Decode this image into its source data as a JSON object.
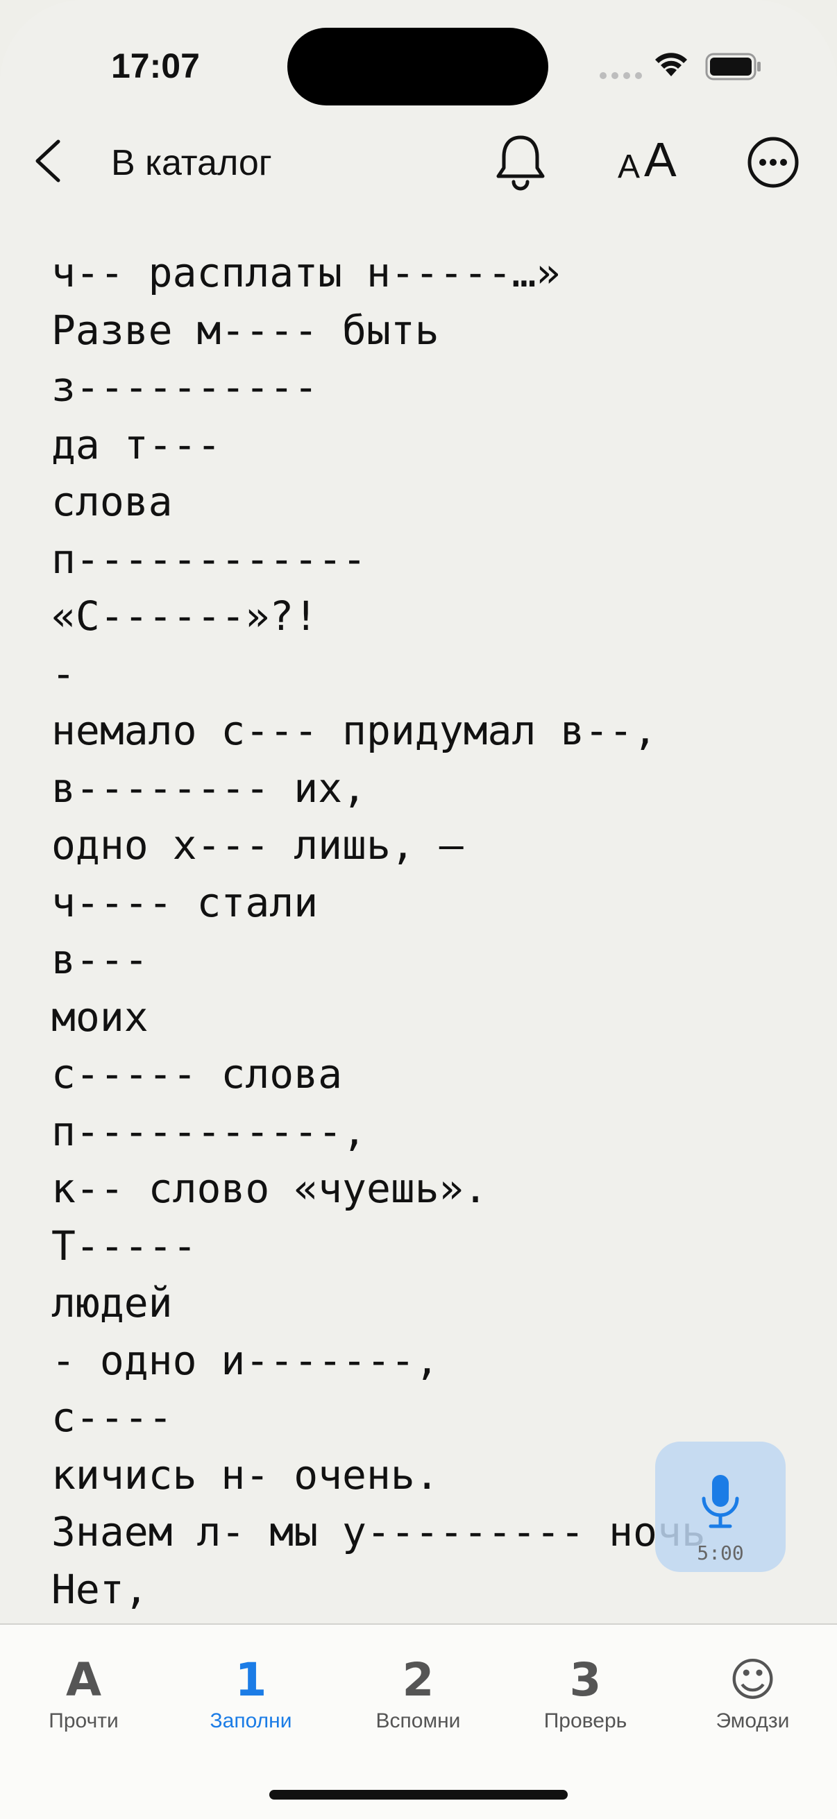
{
  "status_bar": {
    "time": "17:07"
  },
  "nav": {
    "back_label": "В каталог"
  },
  "poem": {
    "lines": [
      "ч-- расплаты н-----…»",
      "Разве м---- быть",
      "з----------",
      "да т---",
      "слова",
      "п------------",
      "«С------»?!",
      "-",
      "немало с--- придумал в--,",
      "в-------- их,",
      "одно х--- лишь, —",
      "ч---- стали",
      "в---",
      "моих",
      "с----- слова",
      "п-----------,",
      "к-- слово «чуешь».",
      "Т-----",
      "людей",
      "- одно и-------,",
      "с----",
      "кичись н- очень.",
      "Знаем л- мы у--------- ночь",
      "Нет,"
    ]
  },
  "mic": {
    "timer": "5:00",
    "icon": "microphone-icon"
  },
  "tabs": [
    {
      "glyph": "A",
      "label": "Прочти",
      "active": false
    },
    {
      "glyph": "1",
      "label": "Заполни",
      "active": true
    },
    {
      "glyph": "2",
      "label": "Вспомни",
      "active": false
    },
    {
      "glyph": "3",
      "label": "Проверь",
      "active": false
    },
    {
      "glyph": "☺",
      "label": "Эмодзи",
      "active": false
    }
  ],
  "colors": {
    "accent": "#1b7ce6",
    "background": "#f0f0ec",
    "mic_bg": "#c4daf2"
  }
}
